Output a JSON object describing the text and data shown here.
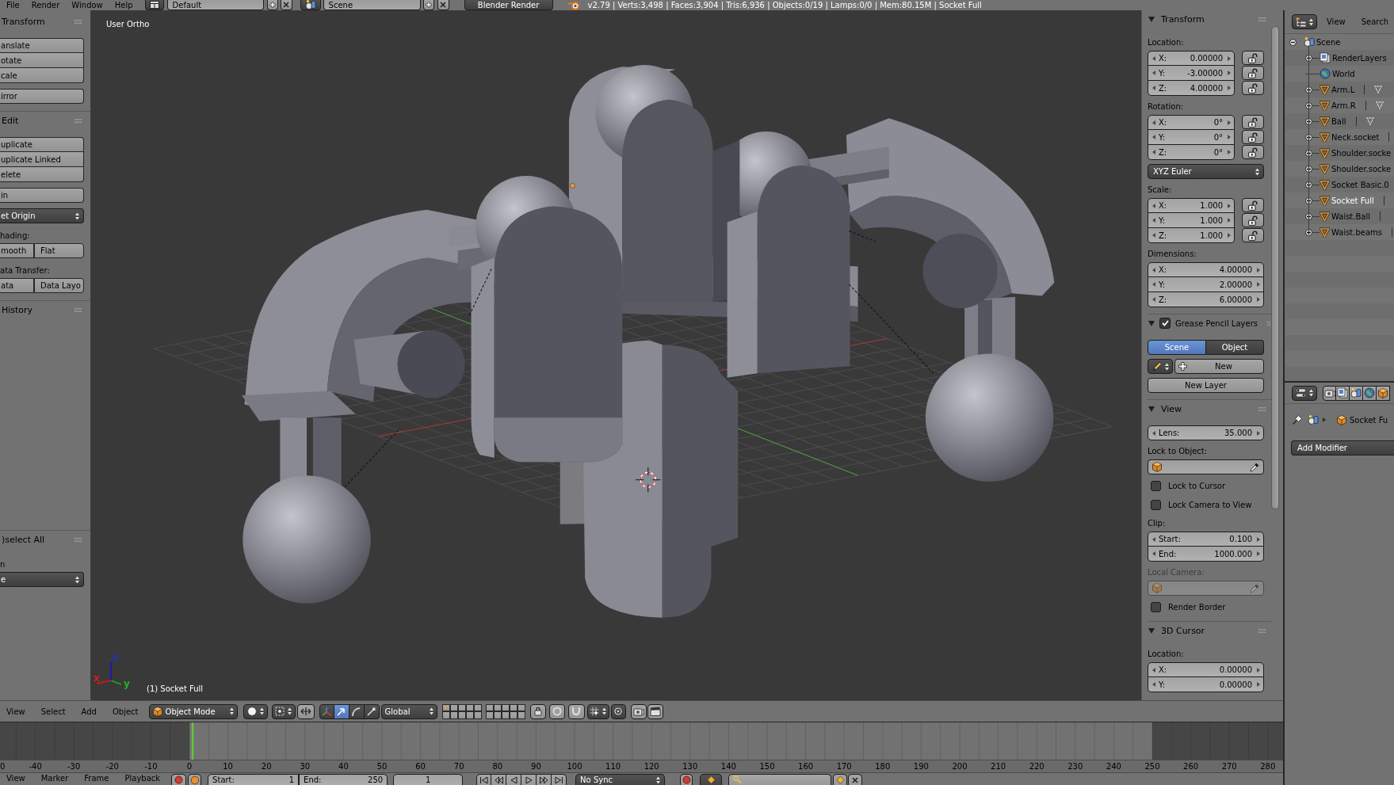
{
  "info_header": {
    "menus": [
      "File",
      "Render",
      "Window",
      "Help"
    ],
    "screen_layout": "Default",
    "scene": "Scene",
    "render_engine": "Blender Render",
    "stats": "v2.79 | Verts:3,498 | Faces:3,904 | Tris:6,936 | Objects:0/19 | Lamps:0/0 | Mem:80.15M | Socket Full"
  },
  "tool_shelf": {
    "panels": [
      {
        "title": "Transform",
        "items": [
          {
            "kind": "stack",
            "buttons": [
              "anslate",
              "otate",
              "cale"
            ]
          },
          {
            "kind": "stack",
            "buttons": [
              "irror"
            ]
          }
        ]
      },
      {
        "title": "Edit",
        "items": [
          {
            "kind": "stack",
            "buttons": [
              "uplicate",
              "uplicate Linked",
              "elete"
            ]
          },
          {
            "kind": "stack",
            "buttons": [
              "in"
            ]
          },
          {
            "kind": "dropdown",
            "value": "et Origin"
          },
          {
            "kind": "label",
            "text": "hading:"
          },
          {
            "kind": "row",
            "buttons": [
              "mooth",
              "Flat"
            ]
          },
          {
            "kind": "label",
            "text": "ata Transfer:"
          },
          {
            "kind": "row",
            "buttons": [
              "ata",
              "Data Layo"
            ]
          }
        ]
      },
      {
        "title": "History"
      }
    ],
    "operator_panel": {
      "title": ")select All",
      "items": [
        {
          "kind": "label",
          "text": "n"
        },
        {
          "kind": "dropdown",
          "value": "e"
        }
      ]
    }
  },
  "viewport": {
    "view_name": "User Ortho",
    "object_label": "(1) Socket Full",
    "axis_labels": [
      {
        "text": "z",
        "color": "#2a2adc"
      },
      {
        "text": "x",
        "color": "#d42020"
      },
      {
        "text": "y",
        "color": "#22b822"
      }
    ]
  },
  "view3d_header": {
    "menus": [
      "View",
      "Select",
      "Add",
      "Object"
    ],
    "mode": "Object Mode",
    "manipulators": [
      {
        "kind": "axes",
        "selected": false
      },
      {
        "kind": "translate",
        "selected": true
      },
      {
        "kind": "rotate",
        "selected": false
      },
      {
        "kind": "scale",
        "selected": false
      }
    ],
    "orientation": "Global",
    "layers": [
      {
        "active_object": true
      },
      {
        "active_object": false
      },
      {
        "active_object": false
      },
      {
        "active_object": false
      },
      {
        "active_object": false
      },
      {
        "active_object": false
      },
      {
        "active_object": false
      },
      {
        "active_object": false
      },
      {
        "active_object": false
      },
      {
        "active_object": false
      },
      {
        "active_object": false
      },
      {
        "active_object": false
      },
      {
        "active_object": false
      },
      {
        "active_object": false
      },
      {
        "active_object": false
      },
      {
        "active_object": false
      },
      {
        "active_object": false
      },
      {
        "active_object": false
      },
      {
        "active_object": false
      },
      {
        "active_object": false
      }
    ]
  },
  "n_panel": {
    "panels": [
      {
        "title": "Transform",
        "expanded": true,
        "items": [
          {
            "kind": "label",
            "text": "Location:",
            "disabled": false
          },
          {
            "kind": "vector",
            "fields": [
              {
                "label": "X:",
                "value": "0.00000",
                "locked": false
              },
              {
                "label": "Y:",
                "value": "-3.00000",
                "locked": false
              },
              {
                "label": "Z:",
                "value": "4.00000",
                "locked": false
              }
            ]
          },
          {
            "kind": "label",
            "text": "Rotation:",
            "disabled": false
          },
          {
            "kind": "vector",
            "fields": [
              {
                "label": "X:",
                "value": "0°",
                "locked": false
              },
              {
                "label": "Y:",
                "value": "0°",
                "locked": false
              },
              {
                "label": "Z:",
                "value": "0°",
                "locked": false
              }
            ]
          },
          {
            "kind": "dropdown",
            "value": "XYZ Euler"
          },
          {
            "kind": "label",
            "text": "Scale:",
            "disabled": false
          },
          {
            "kind": "vector",
            "fields": [
              {
                "label": "X:",
                "value": "1.000",
                "locked": false
              },
              {
                "label": "Y:",
                "value": "1.000",
                "locked": false
              },
              {
                "label": "Z:",
                "value": "1.000",
                "locked": false
              }
            ]
          },
          {
            "kind": "label",
            "text": "Dimensions:",
            "disabled": false
          },
          {
            "kind": "vector",
            "fields": [
              {
                "label": "X:",
                "value": "4.00000"
              },
              {
                "label": "Y:",
                "value": "2.00000"
              },
              {
                "label": "Z:",
                "value": "6.00000"
              }
            ]
          }
        ]
      },
      {
        "title": "Grease Pencil Layers",
        "expanded": true,
        "checked": true,
        "items": [
          {
            "kind": "toggle",
            "options": [
              {
                "label": "Scene",
                "selected": true
              },
              {
                "label": "Object",
                "selected": false
              }
            ]
          },
          {
            "kind": "new_row",
            "label": "New"
          },
          {
            "kind": "button",
            "label": "New Layer"
          }
        ]
      },
      {
        "title": "View",
        "expanded": true,
        "items": [
          {
            "kind": "vector",
            "fields": [
              {
                "label": "Lens:",
                "value": "35.000"
              }
            ]
          },
          {
            "kind": "label",
            "text": "Lock to Object:",
            "disabled": false
          },
          {
            "kind": "object_field",
            "disabled": false
          },
          {
            "kind": "checkbox",
            "label": "Lock to Cursor",
            "checked": false
          },
          {
            "kind": "checkbox",
            "label": "Lock Camera to View",
            "checked": false
          },
          {
            "kind": "label",
            "text": "Clip:",
            "disabled": false
          },
          {
            "kind": "vector",
            "fields": [
              {
                "label": "Start:",
                "value": "0.100"
              },
              {
                "label": "End:",
                "value": "1000.000"
              }
            ]
          },
          {
            "kind": "label",
            "text": "Local Camera:",
            "disabled": true
          },
          {
            "kind": "object_field",
            "disabled": true
          },
          {
            "kind": "checkbox",
            "label": "Render Border",
            "checked": false
          }
        ]
      },
      {
        "title": "3D Cursor",
        "expanded": true,
        "items": [
          {
            "kind": "label",
            "text": "Location:",
            "disabled": false
          },
          {
            "kind": "vector",
            "fields": [
              {
                "label": "X:",
                "value": "0.00000"
              },
              {
                "label": "Y:",
                "value": "0.00000"
              }
            ]
          }
        ]
      }
    ]
  },
  "outliner": {
    "menus": [
      "View",
      "Search"
    ],
    "tree": {
      "name": "Scene",
      "kind": "scene",
      "expanded": true,
      "selected": false,
      "children": [
        {
          "name": "RenderLayers",
          "kind": "render_layers",
          "expanded": false,
          "selected": false
        },
        {
          "name": "World",
          "kind": "world",
          "selected": false
        },
        {
          "name": "Arm.L",
          "kind": "object",
          "expanded": false,
          "selected": false,
          "data_icon": true
        },
        {
          "name": "Arm.R",
          "kind": "object",
          "expanded": false,
          "selected": false,
          "data_icon": true
        },
        {
          "name": "Ball",
          "kind": "object",
          "expanded": false,
          "selected": false,
          "data_icon": true
        },
        {
          "name": "Neck.socket",
          "kind": "object",
          "expanded": false,
          "selected": false,
          "data_icon": false
        },
        {
          "name": "Shoulder.socke",
          "kind": "object",
          "expanded": false,
          "selected": false,
          "data_icon": false
        },
        {
          "name": "Shoulder.socke",
          "kind": "object",
          "expanded": false,
          "selected": false,
          "data_icon": false
        },
        {
          "name": "Socket Basic.0",
          "kind": "object",
          "expanded": false,
          "selected": false,
          "data_icon": false
        },
        {
          "name": "Socket Full",
          "kind": "object",
          "expanded": false,
          "selected": true,
          "data_icon": false
        },
        {
          "name": "Waist.Ball",
          "kind": "object",
          "expanded": false,
          "selected": false,
          "data_icon": false
        },
        {
          "name": "Waist.beams",
          "kind": "object",
          "expanded": false,
          "selected": false,
          "data_icon": false
        }
      ]
    }
  },
  "properties": {
    "context_tabs": [
      {
        "kind": "render"
      },
      {
        "kind": "render_layers"
      },
      {
        "kind": "scene"
      },
      {
        "kind": "world"
      },
      {
        "kind": "object"
      }
    ],
    "breadcrumb": "Socket Fu",
    "add_button": "Add Modifier"
  },
  "timeline": {
    "ruler": [
      "0",
      "-40",
      "-30",
      "-20",
      "-10",
      "0",
      "10",
      "20",
      "30",
      "40",
      "50",
      "60",
      "70",
      "80",
      "90",
      "100",
      "110",
      "120",
      "130",
      "140",
      "150",
      "160",
      "170",
      "180",
      "190",
      "200",
      "210",
      "220",
      "230",
      "240",
      "250",
      "260",
      "270",
      "280"
    ]
  },
  "timeline_header": {
    "menus": [
      "View",
      "Marker",
      "Frame",
      "Playback"
    ],
    "start_label": "Start:",
    "start": "1",
    "end_label": "End:",
    "end": "250",
    "current_frame": "1",
    "sync": "No Sync"
  }
}
